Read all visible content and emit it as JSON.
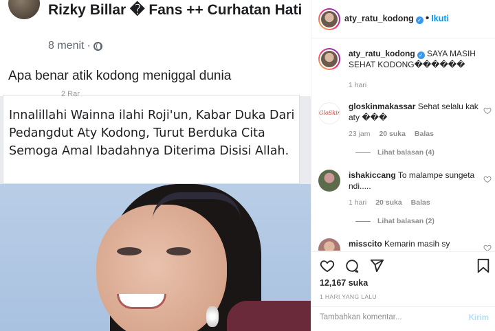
{
  "post_image": {
    "fb_author": "Rizky Billar � Fans ++ Curhatan Hati",
    "fb_time": "8 menit",
    "fb_text": "Apa benar atik kodong meniggal dunia",
    "shared_cut": "2 Rar",
    "shared_text": "Innalillahi Wainna ilahi Roji'un, Kabar Duka Dari Pedangdut Aty Kodong, Turut Berduka Cita Semoga Amal Ibadahnya Diterima Disisi Allah."
  },
  "header": {
    "username": "aty_ratu_kodong",
    "separator": "•",
    "follow_label": "Ikuti",
    "verified_icon": "verified-badge-icon"
  },
  "caption": {
    "username": "aty_ratu_kodong",
    "text": "SAYA MASIH SEHAT KODONG������",
    "time": "1 hari"
  },
  "comments": [
    {
      "username": "gloskinmakassar",
      "text": "Sehat selalu kak aty ���",
      "time": "23 jam",
      "likes": "20 suka",
      "reply": "Balas",
      "view_replies": "Lihat balasan (4)",
      "avatar_text": "GloSkin"
    },
    {
      "username": "ishakiccang",
      "text": "To malampe sungeta ndi.....",
      "time": "1 hari",
      "likes": "20 suka",
      "reply": "Balas",
      "view_replies": "Lihat balasan (2)"
    },
    {
      "username": "misscito",
      "text": "Kemarin masih sy"
    }
  ],
  "actions": {
    "likes": "12,167 suka",
    "posted": "1 HARI YANG LALU",
    "icons": [
      "heart-icon",
      "comment-icon",
      "share-icon",
      "bookmark-icon"
    ]
  },
  "add_comment": {
    "placeholder": "Tambahkan komentar...",
    "send_label": "Kirim"
  },
  "colors": {
    "accent": "#0095f6",
    "send_disabled": "#b2dffc",
    "muted": "#8e8e8e"
  }
}
